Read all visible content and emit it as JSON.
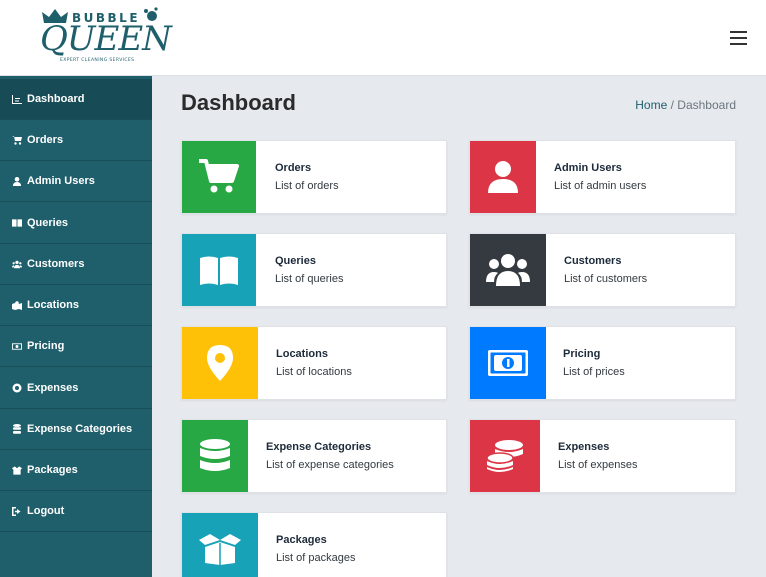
{
  "brand": {
    "logo_top": "BUBBLE",
    "logo_main": "QUEEN",
    "logo_tagline": "EXPERT CLEANING SERVICES"
  },
  "header": {
    "menu_icon": "hamburger-icon"
  },
  "sidebar": {
    "items": [
      {
        "label": "Dashboard",
        "icon": "chart-icon"
      },
      {
        "label": "Orders",
        "icon": "cart-icon"
      },
      {
        "label": "Admin Users",
        "icon": "user-icon"
      },
      {
        "label": "Queries",
        "icon": "book-icon"
      },
      {
        "label": "Customers",
        "icon": "users-icon"
      },
      {
        "label": "Locations",
        "icon": "map-icon"
      },
      {
        "label": "Pricing",
        "icon": "money-icon"
      },
      {
        "label": "Expenses",
        "icon": "coins-icon"
      },
      {
        "label": "Expense Categories",
        "icon": "database-icon"
      },
      {
        "label": "Packages",
        "icon": "box-icon"
      },
      {
        "label": "Logout",
        "icon": "logout-icon"
      }
    ],
    "active": "Dashboard"
  },
  "main": {
    "title": "Dashboard",
    "breadcrumb": {
      "home": "Home",
      "separator": " / ",
      "current": "Dashboard"
    }
  },
  "cards": [
    {
      "title": "Orders",
      "subtitle": "List of orders",
      "icon": "cart-icon",
      "color": "#28a745"
    },
    {
      "title": "Admin Users",
      "subtitle": "List of admin users",
      "icon": "user-icon",
      "color": "#dc3545"
    },
    {
      "title": "Queries",
      "subtitle": "List of queries",
      "icon": "book-icon",
      "color": "#17a2b8"
    },
    {
      "title": "Customers",
      "subtitle": "List of customers",
      "icon": "users-icon",
      "color": "#343a40"
    },
    {
      "title": "Locations",
      "subtitle": "List of locations",
      "icon": "map-marker-icon",
      "color": "#ffc107"
    },
    {
      "title": "Pricing",
      "subtitle": "List of prices",
      "icon": "money-bill-icon",
      "color": "#007bff"
    },
    {
      "title": "Expense Categories",
      "subtitle": "List of expense categories",
      "icon": "database-icon",
      "color": "#28a745"
    },
    {
      "title": "Expenses",
      "subtitle": "List of expenses",
      "icon": "coins-icon",
      "color": "#dc3545"
    },
    {
      "title": "Packages",
      "subtitle": "List of packages",
      "icon": "box-open-icon",
      "color": "#17a2b8"
    }
  ]
}
